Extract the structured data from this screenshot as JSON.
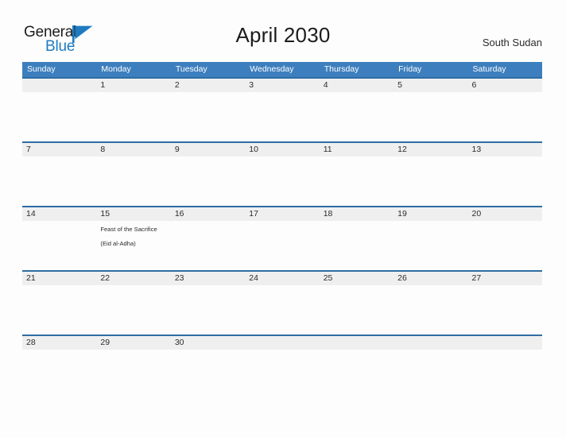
{
  "brand": {
    "name_top": "General",
    "name_bottom": "Blue",
    "flag_icon": "blue-flag-triangle",
    "color_top": "#1c1c1c",
    "color_bottom": "#1f7ac0",
    "flag_color": "#1f7ac0"
  },
  "header": {
    "title": "April 2030",
    "country": "South Sudan"
  },
  "colors": {
    "header_blue": "#3d7fbe",
    "row_rule_blue": "#2e6da4",
    "daynum_band": "#efefef",
    "page_background": "#fdfdfd",
    "text": "#2b2b2b"
  },
  "calendar": {
    "weekdays": [
      "Sunday",
      "Monday",
      "Tuesday",
      "Wednesday",
      "Thursday",
      "Friday",
      "Saturday"
    ],
    "weeks": [
      [
        {
          "day": "",
          "event": ""
        },
        {
          "day": "1",
          "event": ""
        },
        {
          "day": "2",
          "event": ""
        },
        {
          "day": "3",
          "event": ""
        },
        {
          "day": "4",
          "event": ""
        },
        {
          "day": "5",
          "event": ""
        },
        {
          "day": "6",
          "event": ""
        }
      ],
      [
        {
          "day": "7",
          "event": ""
        },
        {
          "day": "8",
          "event": ""
        },
        {
          "day": "9",
          "event": ""
        },
        {
          "day": "10",
          "event": ""
        },
        {
          "day": "11",
          "event": ""
        },
        {
          "day": "12",
          "event": ""
        },
        {
          "day": "13",
          "event": ""
        }
      ],
      [
        {
          "day": "14",
          "event": ""
        },
        {
          "day": "15",
          "event": "Feast of the Sacrifice (Eid al-Adha)"
        },
        {
          "day": "16",
          "event": ""
        },
        {
          "day": "17",
          "event": ""
        },
        {
          "day": "18",
          "event": ""
        },
        {
          "day": "19",
          "event": ""
        },
        {
          "day": "20",
          "event": ""
        }
      ],
      [
        {
          "day": "21",
          "event": ""
        },
        {
          "day": "22",
          "event": ""
        },
        {
          "day": "23",
          "event": ""
        },
        {
          "day": "24",
          "event": ""
        },
        {
          "day": "25",
          "event": ""
        },
        {
          "day": "26",
          "event": ""
        },
        {
          "day": "27",
          "event": ""
        }
      ],
      [
        {
          "day": "28",
          "event": ""
        },
        {
          "day": "29",
          "event": ""
        },
        {
          "day": "30",
          "event": ""
        },
        {
          "day": "",
          "event": ""
        },
        {
          "day": "",
          "event": ""
        },
        {
          "day": "",
          "event": ""
        },
        {
          "day": "",
          "event": ""
        }
      ]
    ]
  }
}
